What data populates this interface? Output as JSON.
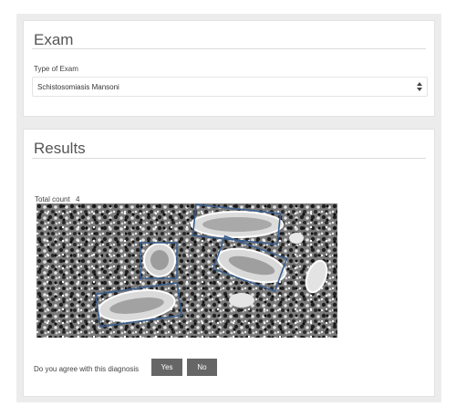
{
  "exam": {
    "title": "Exam",
    "type_label": "Type of Exam",
    "type_value": "Schistosomiasis Mansoni"
  },
  "results": {
    "title": "Results",
    "total_count_label": "Total count",
    "total_count_value": "4",
    "agree_prompt": "Do you agree with this diagnosis",
    "yes_label": "Yes",
    "no_label": "No"
  },
  "colors": {
    "button_bg": "#666666",
    "detection_box": "#3b5f8e",
    "panel_bg": "#ffffff",
    "page_bg": "#ececec"
  },
  "icons": {
    "select_arrows": "updown-arrows-icon"
  }
}
